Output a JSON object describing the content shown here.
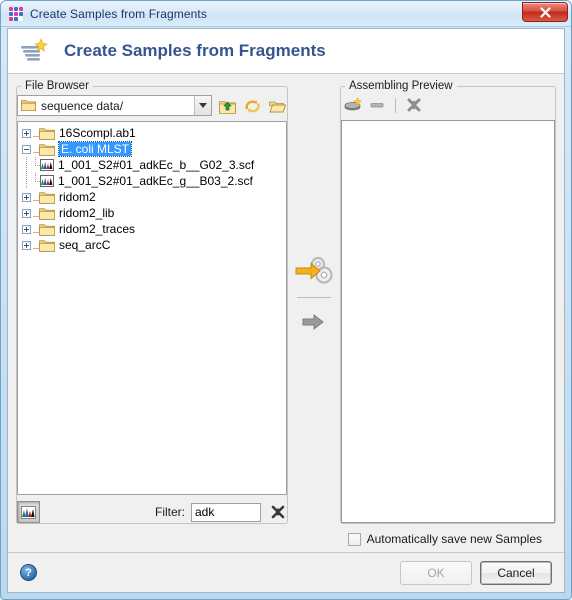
{
  "window": {
    "title": "Create Samples from Fragments",
    "app_icon": "grid-dots-icon",
    "close_label": "x"
  },
  "banner": {
    "icon": "create-samples-icon",
    "title": "Create Samples from Fragments"
  },
  "file_browser": {
    "legend": "File Browser",
    "path": {
      "value": "sequence data/",
      "icon": "folder-icon",
      "arrow": "chevron-down-icon"
    },
    "toolbar": [
      {
        "name": "folder-up-button",
        "title": "Up one level"
      },
      {
        "name": "refresh-button",
        "title": "Refresh"
      },
      {
        "name": "open-folder-button",
        "title": "Open folder"
      }
    ],
    "tree": [
      {
        "label": "16Scompl.ab1",
        "type": "folder",
        "expander": "plus",
        "depth": 0,
        "selected": false
      },
      {
        "label": "E. coli MLST",
        "type": "folder",
        "expander": "minus",
        "depth": 0,
        "selected": true
      },
      {
        "label": "1_001_S2#01_adkEc_b__G02_3.scf",
        "type": "trace",
        "expander": "none",
        "depth": 1,
        "selected": false
      },
      {
        "label": "1_001_S2#01_adkEc_g__B03_2.scf",
        "type": "trace",
        "expander": "none",
        "depth": 1,
        "selected": false
      },
      {
        "label": "ridom2",
        "type": "folder",
        "expander": "plus",
        "depth": 0,
        "selected": false
      },
      {
        "label": "ridom2_lib",
        "type": "folder",
        "expander": "plus",
        "depth": 0,
        "selected": false
      },
      {
        "label": "ridom2_traces",
        "type": "folder",
        "expander": "plus",
        "depth": 0,
        "selected": false
      },
      {
        "label": "seq_arcC",
        "type": "folder",
        "expander": "plus",
        "depth": 0,
        "selected": false
      }
    ],
    "bottom": {
      "trace_toggle_name": "show-traces-toggle",
      "filter_label": "Filter:",
      "filter_value": "adk",
      "filter_placeholder": "",
      "clear_name": "clear-filter-button"
    }
  },
  "transfer": {
    "assemble_button": "assemble-button",
    "add_button": "add-button"
  },
  "assembling_preview": {
    "legend": "Assembling Preview",
    "toolbar": [
      {
        "name": "add-sample-button"
      },
      {
        "name": "remove-sample-button"
      },
      {
        "name": "delete-all-button"
      }
    ],
    "items": []
  },
  "options": {
    "autosave_label": "Automatically save new Samples",
    "autosave_checked": false
  },
  "footer": {
    "help_label": "?",
    "ok_label": "OK",
    "ok_enabled": false,
    "cancel_label": "Cancel",
    "cancel_enabled": true
  },
  "colors": {
    "accent_blue": "#35558f",
    "selection_blue": "#3399ff",
    "folder_yellow": "#f0c96a",
    "arrow_yellow": "#f5b91e",
    "window_bg": "#f0f0f0"
  }
}
